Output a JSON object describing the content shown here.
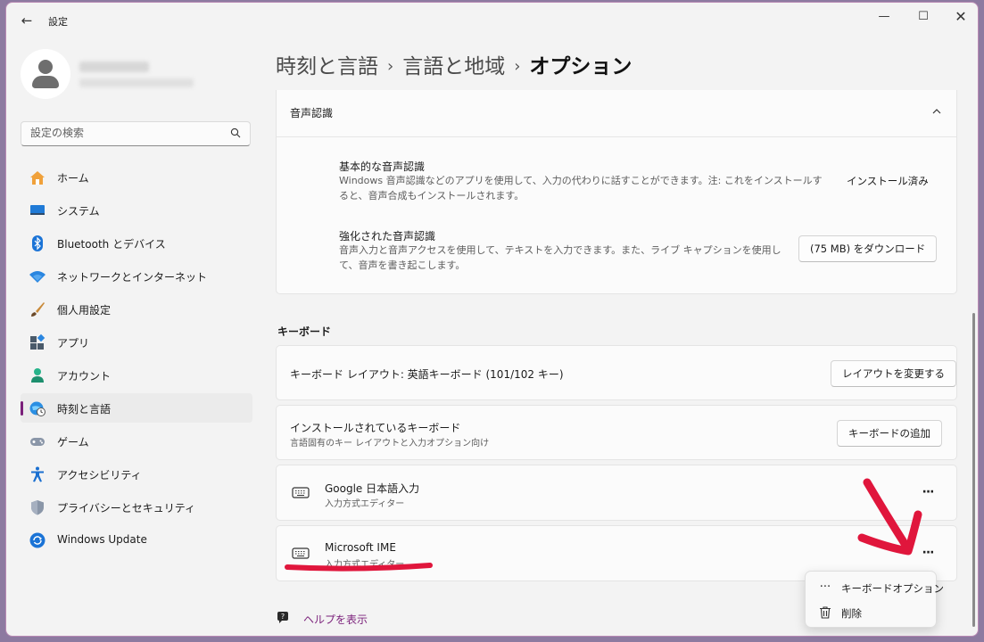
{
  "app": {
    "title": "設定",
    "back_icon": "arrow-left-icon"
  },
  "window_controls": {
    "minimize": "—",
    "maximize": "☐",
    "close": "✕"
  },
  "search": {
    "placeholder": "設定の検索"
  },
  "sidebar": {
    "items": [
      {
        "label": "ホーム",
        "icon": "home-icon"
      },
      {
        "label": "システム",
        "icon": "display-icon"
      },
      {
        "label": "Bluetooth とデバイス",
        "icon": "bluetooth-icon"
      },
      {
        "label": "ネットワークとインターネット",
        "icon": "wifi-icon"
      },
      {
        "label": "個人用設定",
        "icon": "brush-icon"
      },
      {
        "label": "アプリ",
        "icon": "apps-icon"
      },
      {
        "label": "アカウント",
        "icon": "account-icon"
      },
      {
        "label": "時刻と言語",
        "icon": "globe-clock-icon",
        "selected": true
      },
      {
        "label": "ゲーム",
        "icon": "gamepad-icon"
      },
      {
        "label": "アクセシビリティ",
        "icon": "accessibility-icon"
      },
      {
        "label": "プライバシーとセキュリティ",
        "icon": "shield-icon"
      },
      {
        "label": "Windows Update",
        "icon": "update-icon"
      }
    ]
  },
  "breadcrumb": {
    "level1": "時刻と言語",
    "level2": "言語と地域",
    "current": "オプション",
    "separator": "›"
  },
  "speech": {
    "header": "音声認識",
    "basic": {
      "title": "基本的な音声認識",
      "description": "Windows 音声認識などのアプリを使用して、入力の代わりに話すことができます。注: これをインストールすると、音声合成もインストールされます。",
      "status": "インストール済み"
    },
    "enhanced": {
      "title": "強化された音声認識",
      "description": "音声入力と音声アクセスを使用して、テキストを入力できます。また、ライブ キャプションを使用して、音声を書き起こします。",
      "button": "(75 MB) をダウンロード"
    }
  },
  "keyboard": {
    "heading": "キーボード",
    "layout": {
      "label": "キーボード レイアウト: 英語キーボード (101/102 キー)",
      "button": "レイアウトを変更する"
    },
    "installed": {
      "title": "インストールされているキーボード",
      "subtitle": "言語固有のキー レイアウトと入力オプション向け",
      "button": "キーボードの追加"
    },
    "keyboards": [
      {
        "name": "Google 日本語入力",
        "type": "入力方式エディター"
      },
      {
        "name": "Microsoft IME",
        "type": "入力方式エディター"
      }
    ],
    "more_label": "···"
  },
  "help": {
    "label": "ヘルプを表示"
  },
  "context_menu": [
    {
      "label": "キーボードオプション",
      "icon": "more-icon"
    },
    {
      "label": "削除",
      "icon": "trash-icon"
    }
  ],
  "colors": {
    "accent": "#7a1f7a",
    "annotation": "#e0163c"
  }
}
